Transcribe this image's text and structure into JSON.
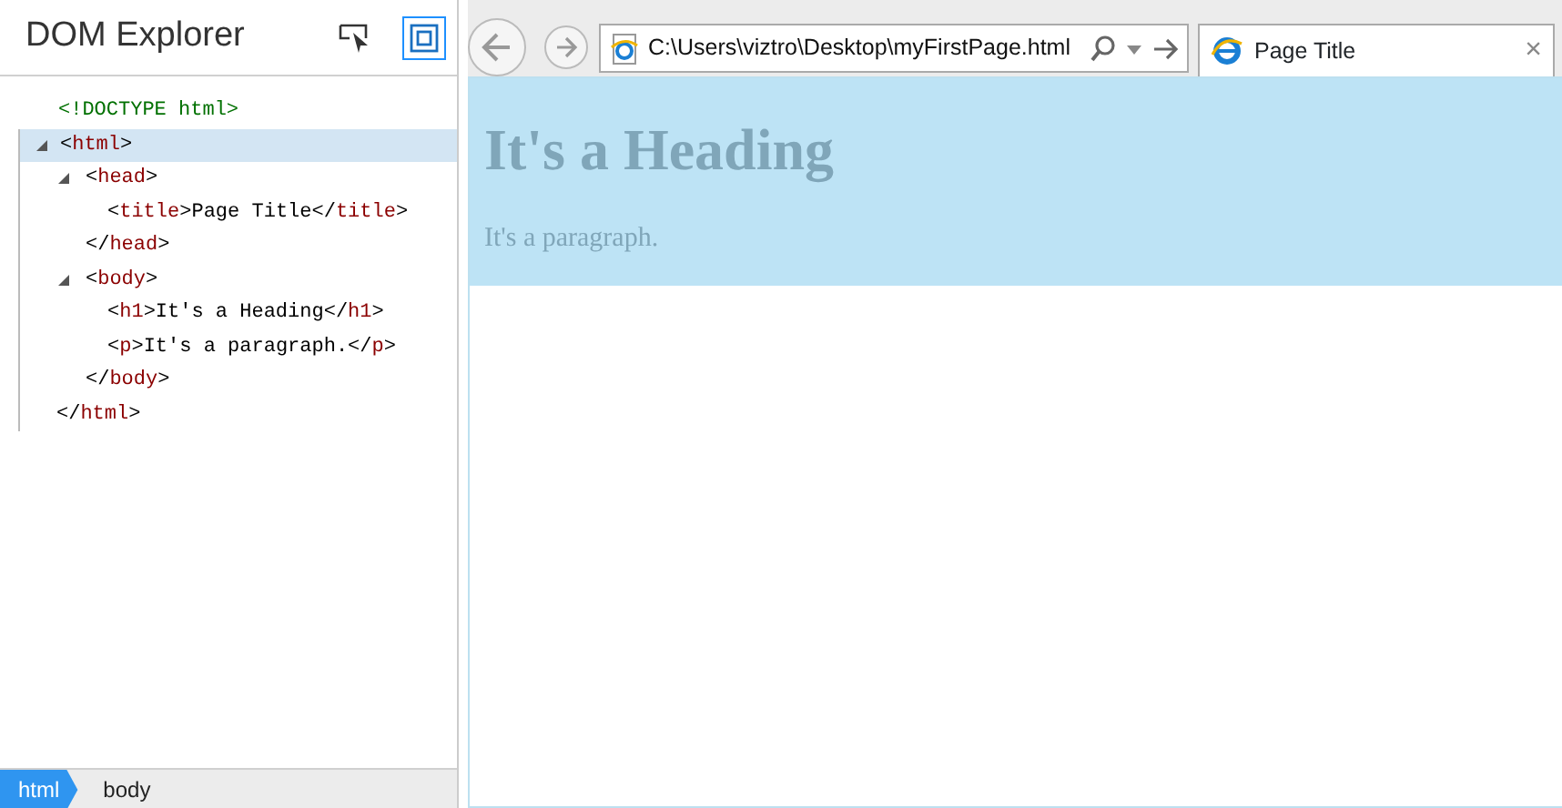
{
  "devtools": {
    "title": "DOM Explorer",
    "tools": [
      {
        "kind": "select-element",
        "on": false
      },
      {
        "kind": "highlight",
        "on": true
      }
    ],
    "tree": [
      {
        "segments": [
          {
            "kind": "doctype",
            "text": "<!DOCTYPE html>"
          }
        ],
        "selected": false
      },
      {
        "segments": [
          {
            "kind": "punct",
            "text": "<"
          },
          {
            "kind": "tag",
            "text": "html"
          },
          {
            "kind": "punct",
            "text": ">"
          }
        ],
        "selected": true,
        "expanded": true,
        "closing": [
          {
            "kind": "punct",
            "text": "</"
          },
          {
            "kind": "tag",
            "text": "html"
          },
          {
            "kind": "punct",
            "text": ">"
          }
        ],
        "children": [
          {
            "segments": [
              {
                "kind": "punct",
                "text": "<"
              },
              {
                "kind": "tag",
                "text": "head"
              },
              {
                "kind": "punct",
                "text": ">"
              }
            ],
            "selected": false,
            "expanded": true,
            "closing": [
              {
                "kind": "punct",
                "text": "</"
              },
              {
                "kind": "tag",
                "text": "head"
              },
              {
                "kind": "punct",
                "text": ">"
              }
            ],
            "children": [
              {
                "segments": [
                  {
                    "kind": "punct",
                    "text": "<"
                  },
                  {
                    "kind": "tag",
                    "text": "title"
                  },
                  {
                    "kind": "punct",
                    "text": ">"
                  },
                  {
                    "kind": "text",
                    "text": "Page Title"
                  },
                  {
                    "kind": "punct",
                    "text": "</"
                  },
                  {
                    "kind": "tag",
                    "text": "title"
                  },
                  {
                    "kind": "punct",
                    "text": ">"
                  }
                ],
                "selected": false
              }
            ]
          },
          {
            "segments": [
              {
                "kind": "punct",
                "text": "<"
              },
              {
                "kind": "tag",
                "text": "body"
              },
              {
                "kind": "punct",
                "text": ">"
              }
            ],
            "selected": false,
            "expanded": true,
            "closing": [
              {
                "kind": "punct",
                "text": "</"
              },
              {
                "kind": "tag",
                "text": "body"
              },
              {
                "kind": "punct",
                "text": ">"
              }
            ],
            "children": [
              {
                "segments": [
                  {
                    "kind": "punct",
                    "text": "<"
                  },
                  {
                    "kind": "tag",
                    "text": "h1"
                  },
                  {
                    "kind": "punct",
                    "text": ">"
                  },
                  {
                    "kind": "text",
                    "text": "It's a Heading"
                  },
                  {
                    "kind": "punct",
                    "text": "</"
                  },
                  {
                    "kind": "tag",
                    "text": "h1"
                  },
                  {
                    "kind": "punct",
                    "text": ">"
                  }
                ],
                "selected": false
              },
              {
                "segments": [
                  {
                    "kind": "punct",
                    "text": "<"
                  },
                  {
                    "kind": "tag",
                    "text": "p"
                  },
                  {
                    "kind": "punct",
                    "text": ">"
                  },
                  {
                    "kind": "text",
                    "text": "It's a paragraph."
                  },
                  {
                    "kind": "punct",
                    "text": "</"
                  },
                  {
                    "kind": "tag",
                    "text": "p"
                  },
                  {
                    "kind": "punct",
                    "text": ">"
                  }
                ],
                "selected": false
              }
            ]
          }
        ]
      }
    ],
    "breadcrumbs": [
      {
        "label": "html",
        "selected": true
      },
      {
        "label": "body",
        "selected": false
      }
    ]
  },
  "browser": {
    "address": "C:\\Users\\viztro\\Desktop\\myFirstPage.html",
    "tab": {
      "title": "Page Title",
      "close": "×"
    },
    "page": {
      "highlighted": true,
      "heading": "It's a Heading",
      "paragraph": "It's a paragraph."
    }
  }
}
